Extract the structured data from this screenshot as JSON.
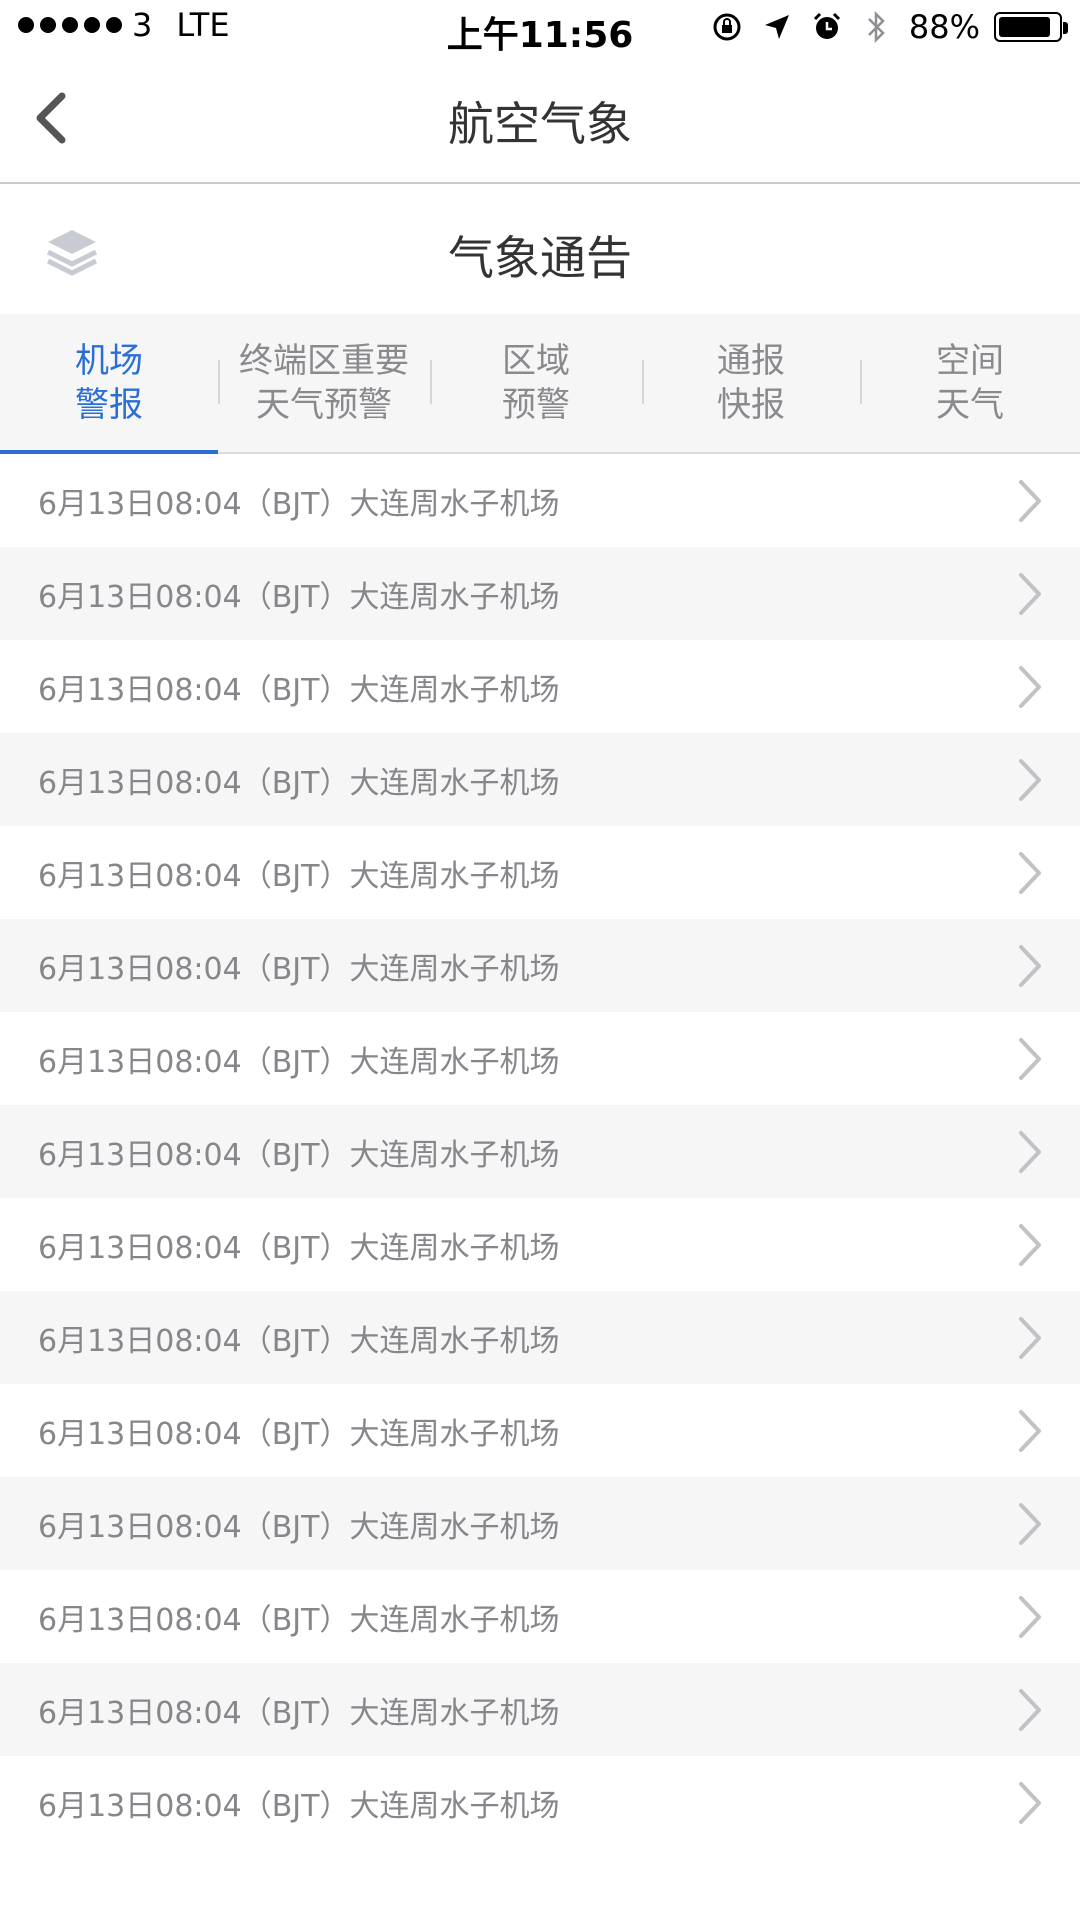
{
  "status_bar": {
    "carrier": "3",
    "network": "LTE",
    "time": "上午11:56",
    "battery_percent": "88%",
    "battery_level": 0.88,
    "icons": [
      "orientation-lock-icon",
      "location-arrow-icon",
      "alarm-icon",
      "bluetooth-icon"
    ]
  },
  "nav": {
    "title": "航空气象",
    "back_icon": "chevron-left-icon"
  },
  "section": {
    "title": "气象通告",
    "layers_icon": "layers-icon"
  },
  "tabs": [
    {
      "label": "机场\n警报",
      "active": true
    },
    {
      "label": "终端区重要\n天气预警",
      "active": false
    },
    {
      "label": "区域\n预警",
      "active": false
    },
    {
      "label": "通报\n快报",
      "active": false
    },
    {
      "label": "空间\n天气",
      "active": false
    }
  ],
  "list": {
    "items": [
      "6月13日08:04（BJT）大连周水子机场",
      "6月13日08:04（BJT）大连周水子机场",
      "6月13日08:04（BJT）大连周水子机场",
      "6月13日08:04（BJT）大连周水子机场",
      "6月13日08:04（BJT）大连周水子机场",
      "6月13日08:04（BJT）大连周水子机场",
      "6月13日08:04（BJT）大连周水子机场",
      "6月13日08:04（BJT）大连周水子机场",
      "6月13日08:04（BJT）大连周水子机场",
      "6月13日08:04（BJT）大连周水子机场",
      "6月13日08:04（BJT）大连周水子机场",
      "6月13日08:04（BJT）大连周水子机场",
      "6月13日08:04（BJT）大连周水子机场",
      "6月13日08:04（BJT）大连周水子机场",
      "6月13日08:04（BJT）大连周水子机场"
    ],
    "row_icon": "chevron-right-icon"
  },
  "colors": {
    "accent": "#2b6fd6",
    "text_primary": "#333333",
    "text_secondary": "#86868b",
    "row_alt_bg": "#f6f6f7"
  }
}
